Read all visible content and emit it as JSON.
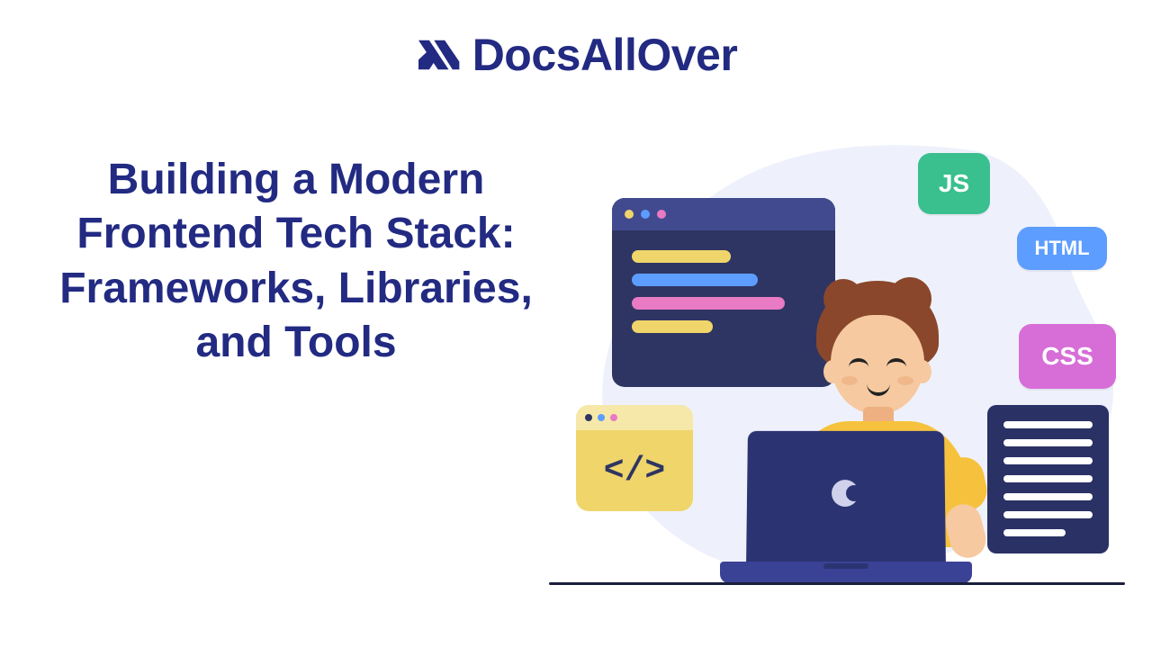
{
  "brand": {
    "name": "DocsAllOver",
    "logo_icon": "double-chevron-x-icon",
    "color": "#222a82"
  },
  "hero": {
    "title": "Building a Modern Frontend Tech Stack: Frameworks, Libraries, and Tools"
  },
  "illustration": {
    "tags": {
      "js": {
        "label": "JS",
        "color": "#3abf8e"
      },
      "html": {
        "label": "HTML",
        "color": "#5c9dff"
      },
      "css": {
        "label": "CSS",
        "color": "#d76ed7"
      }
    },
    "code_window": {
      "bg": "#2e3562",
      "titlebar": "#424a8f",
      "dot_colors": [
        "#f0d56b",
        "#5c9dff",
        "#e97ac4"
      ],
      "line_colors": [
        "#f0d56b",
        "#5c9dff",
        "#e97ac4",
        "#f0d56b"
      ]
    },
    "small_window": {
      "bg": "#f0d56b",
      "symbol": "</>"
    },
    "document_card": {
      "bg": "#2a3165",
      "lines": 7
    },
    "laptop": {
      "screen": "#2b3372",
      "base": "#3a4296"
    },
    "person": {
      "hair": "#8a472b",
      "skin": "#f6c9a0",
      "shirt": "#f6c23e"
    },
    "blob_color": "#eef1fb"
  }
}
